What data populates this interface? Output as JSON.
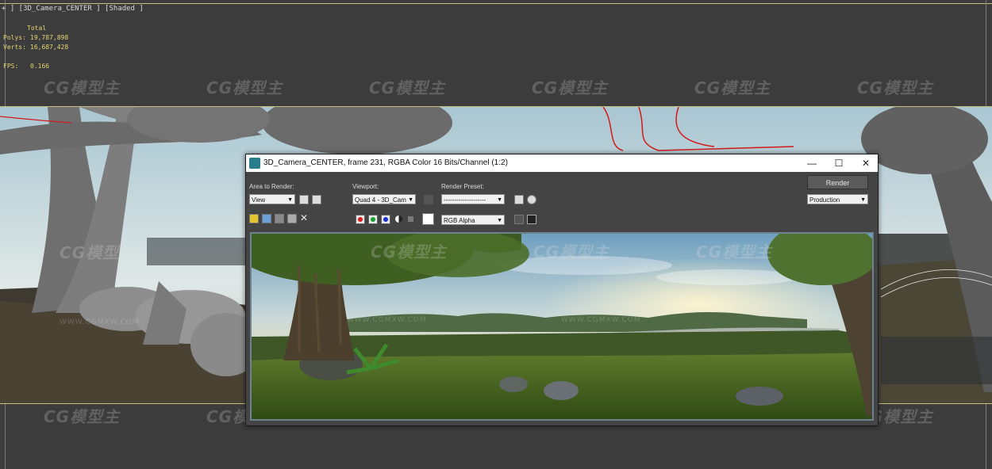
{
  "viewport": {
    "label": "+ ] [3D_Camera_CENTER ] [Shaded ]",
    "stats": {
      "header": "Total",
      "polys_label": "Polys:",
      "polys_value": "19,787,898",
      "verts_label": "Verts:",
      "verts_value": "16,687,428",
      "fps_label": "FPS:",
      "fps_value": "0.166"
    },
    "watermark_text": "CG模型主",
    "watermark_url": "WWW.CGMXW.COM"
  },
  "render_window": {
    "title": "3D_Camera_CENTER, frame 231, RGBA Color 16 Bits/Channel (1:2)",
    "minimize_icon": "—",
    "maximize_icon": "☐",
    "close_icon": "✕",
    "area_to_render_label": "Area to Render:",
    "area_to_render_value": "View",
    "viewport_label": "Viewport:",
    "viewport_value": "Quad 4 - 3D_Cam",
    "render_preset_label": "Render Preset:",
    "render_preset_value": "--------------------",
    "render_button": "Render",
    "production_value": "Production",
    "channel_display_value": "RGB Alpha"
  },
  "colors": {
    "viewport_bg": "#3c3c3c",
    "stats_text": "#e3d46f",
    "channel_red": "#e11919",
    "channel_green": "#17a02b",
    "channel_blue": "#1a2fd8"
  }
}
